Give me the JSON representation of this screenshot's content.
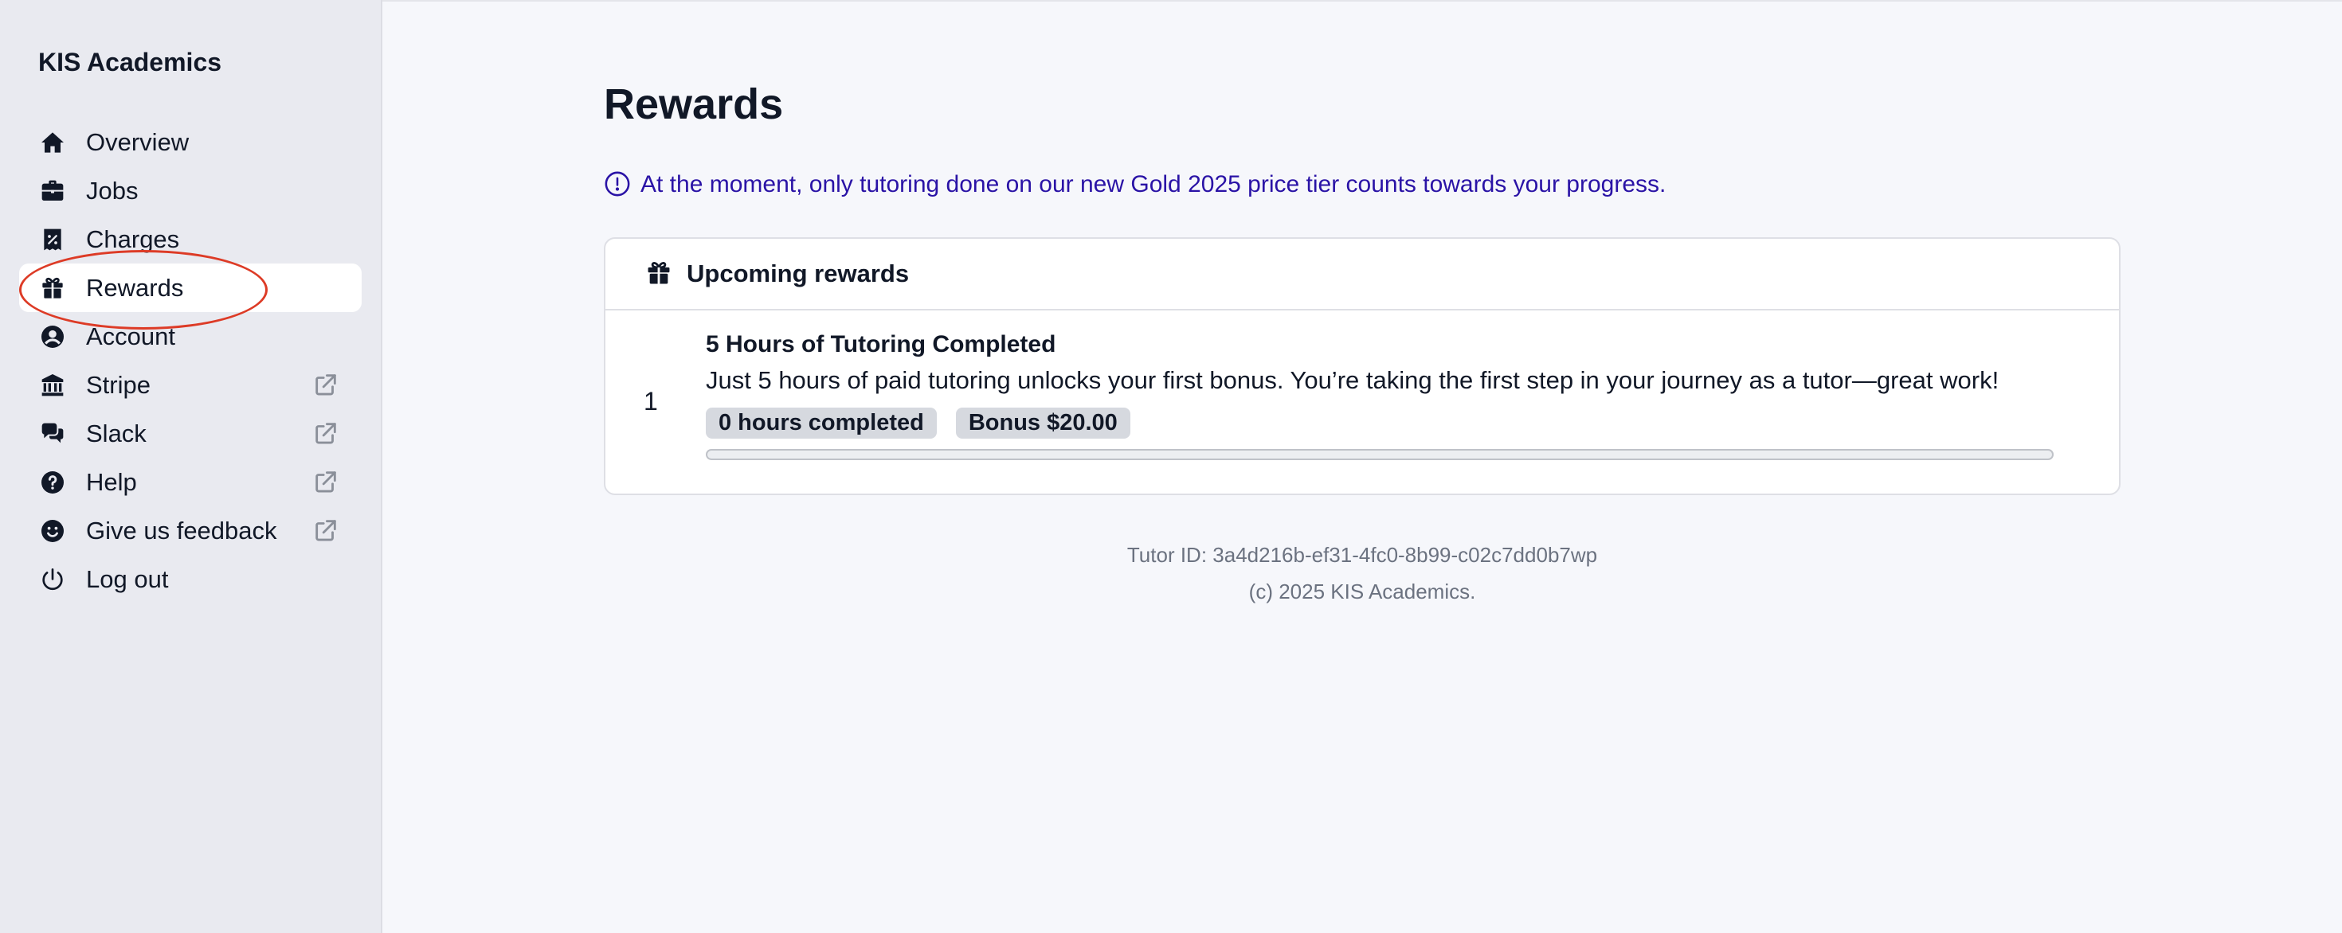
{
  "app": {
    "brand": "KIS Academics"
  },
  "sidebar": {
    "items": [
      {
        "label": "Overview",
        "icon": "home-icon",
        "external": false,
        "active": false
      },
      {
        "label": "Jobs",
        "icon": "briefcase-icon",
        "external": false,
        "active": false
      },
      {
        "label": "Charges",
        "icon": "receipt-percent-icon",
        "external": false,
        "active": false
      },
      {
        "label": "Rewards",
        "icon": "gift-icon",
        "external": false,
        "active": true
      },
      {
        "label": "Account",
        "icon": "user-circle-icon",
        "external": false,
        "active": false
      },
      {
        "label": "Stripe",
        "icon": "bank-icon",
        "external": true,
        "active": false
      },
      {
        "label": "Slack",
        "icon": "chat-bubbles-icon",
        "external": true,
        "active": false
      },
      {
        "label": "Help",
        "icon": "question-circle-icon",
        "external": true,
        "active": false
      },
      {
        "label": "Give us feedback",
        "icon": "smiley-icon",
        "external": true,
        "active": false
      },
      {
        "label": "Log out",
        "icon": "power-icon",
        "external": false,
        "active": false
      }
    ]
  },
  "main": {
    "title": "Rewards",
    "notice": "At the moment, only tutoring done on our new Gold 2025 price tier counts towards your progress.",
    "card": {
      "header": "Upcoming rewards",
      "rewards": [
        {
          "number": "1",
          "title": "5 Hours of Tutoring Completed",
          "description": "Just 5 hours of paid tutoring unlocks your first bonus. You’re taking the first step in your journey as a tutor—great work!",
          "hours_badge": "0 hours completed",
          "bonus_badge": "Bonus $20.00",
          "progress_fraction": 0
        }
      ]
    },
    "footer": {
      "tutor_id": "Tutor ID: 3a4d216b-ef31-4fc0-8b99-c02c7dd0b7wp",
      "copyright": "(c) 2025 KIS Academics."
    }
  },
  "colors": {
    "sidebar_bg": "#e9eaf0",
    "page_bg": "#f6f7fb",
    "notice_text": "#2a13a6",
    "annotation": "#dd3b26",
    "badge_bg": "#d6d9df"
  }
}
